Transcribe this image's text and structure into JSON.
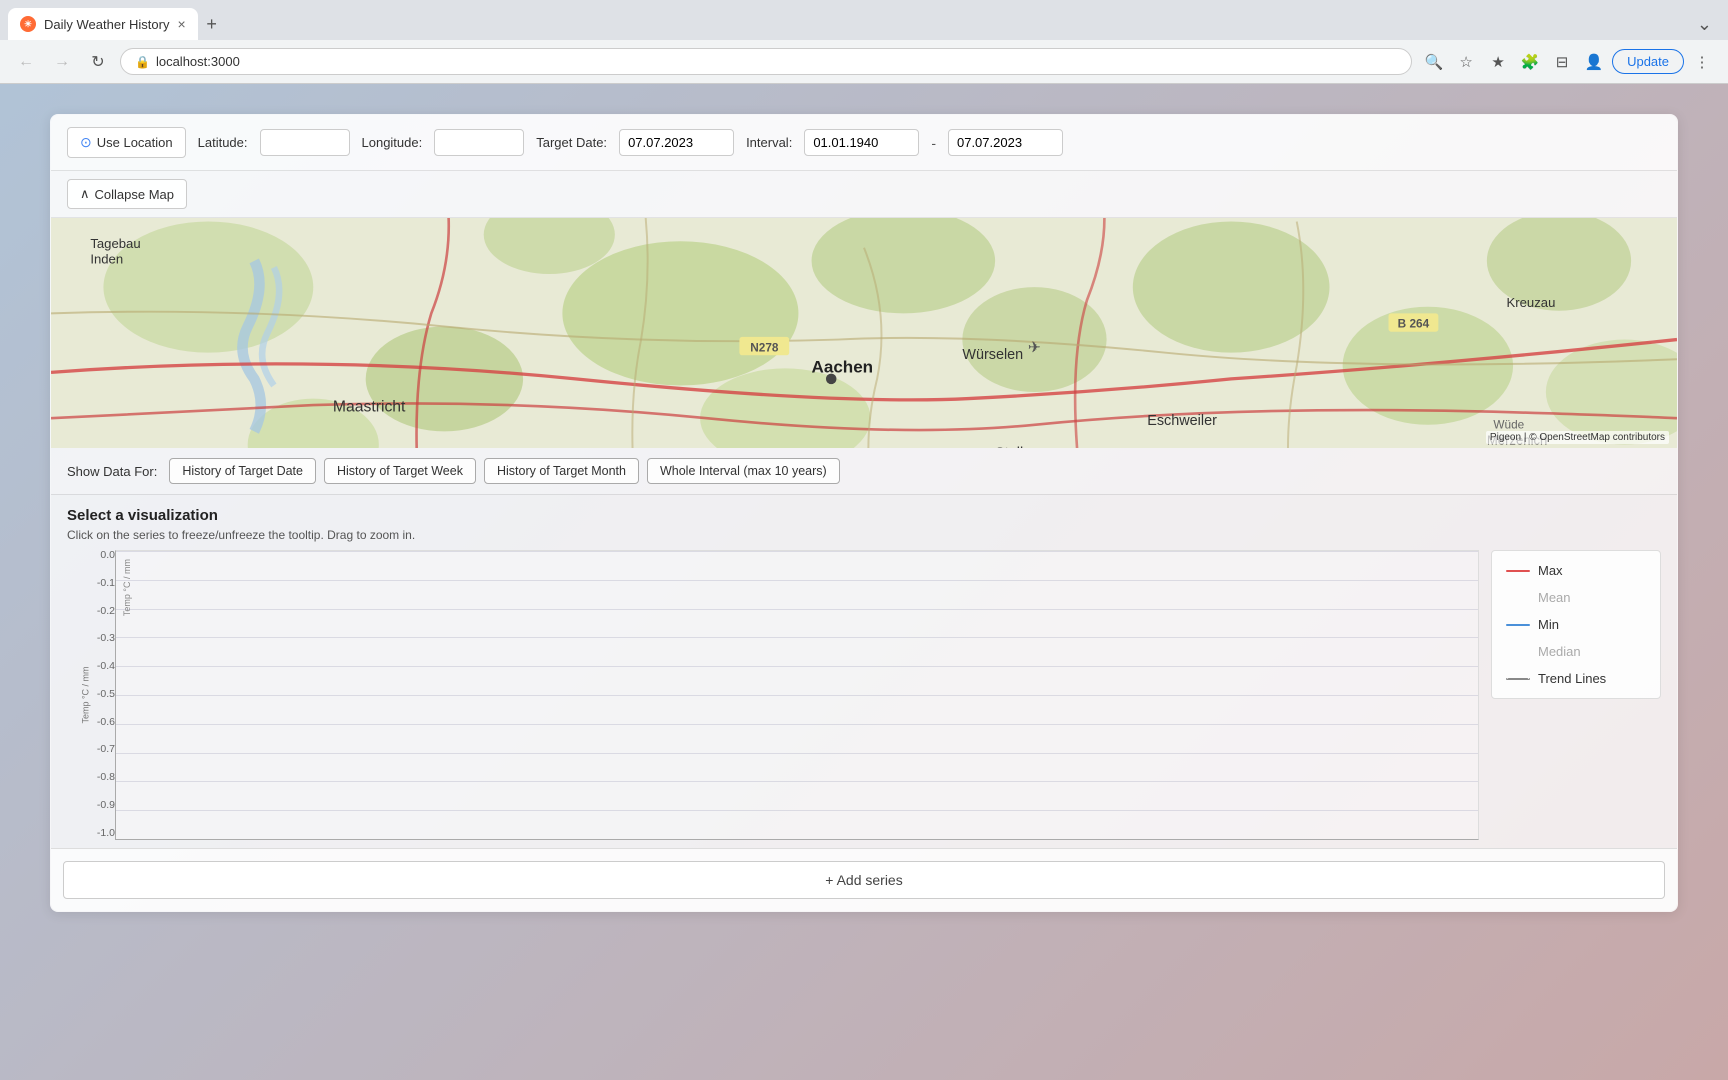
{
  "browser": {
    "tab_title": "Daily Weather History",
    "tab_favicon": "☀",
    "url": "localhost:3000",
    "update_btn_label": "Update"
  },
  "controls": {
    "use_location_label": "Use Location",
    "latitude_label": "Latitude:",
    "latitude_value": "",
    "longitude_label": "Longitude:",
    "longitude_value": "",
    "target_date_label": "Target Date:",
    "target_date_value": "07.07.2023",
    "interval_label": "Interval:",
    "interval_start_value": "01.01.1940",
    "interval_end_value": "07.07.2023"
  },
  "map": {
    "collapse_btn_label": "Collapse Map",
    "attribution_text": "Pigeon",
    "attribution_suffix": " | © OpenStreetMap contributors"
  },
  "show_data": {
    "label": "Show Data For:",
    "tabs": [
      "History of Target Date",
      "History of Target Week",
      "History of Target Month",
      "Whole Interval (max 10 years)"
    ]
  },
  "visualization": {
    "title": "Select a visualization",
    "hint": "Click on the series to freeze/unfreeze the tooltip. Drag to zoom in.",
    "y_axis_label": "Temp °C / mm",
    "y_ticks": [
      "0.0",
      "-0.1",
      "-0.2",
      "-0.3",
      "-0.4",
      "-0.5",
      "-0.6",
      "-0.7",
      "-0.8",
      "-0.9",
      "-1.0"
    ]
  },
  "legend": {
    "items": [
      {
        "key": "max",
        "label": "Max",
        "style": "red",
        "active": true
      },
      {
        "key": "mean",
        "label": "Mean",
        "style": "none",
        "active": false
      },
      {
        "key": "min",
        "label": "Min",
        "style": "blue",
        "active": true
      },
      {
        "key": "median",
        "label": "Median",
        "style": "none",
        "active": false
      },
      {
        "key": "trend_lines",
        "label": "Trend Lines",
        "style": "dashed",
        "active": true
      }
    ]
  },
  "add_series": {
    "btn_label": "+ Add series"
  }
}
